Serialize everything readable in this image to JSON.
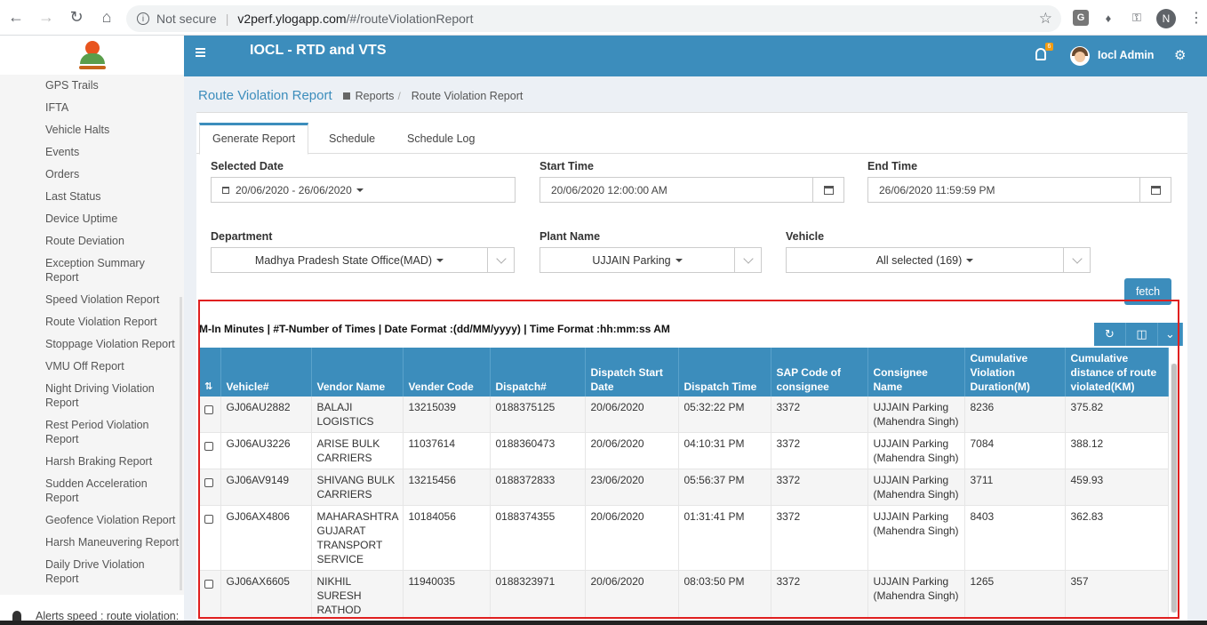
{
  "browser": {
    "security": "Not secure",
    "url_host": "v2perf.ylogapp.com",
    "url_path": "/#/routeViolationReport",
    "profile_initial": "N"
  },
  "sidebar": {
    "items": [
      "GPS Trails",
      "IFTA",
      "Vehicle Halts",
      "Events",
      "Orders",
      "Last Status",
      "Device Uptime",
      "Route Deviation",
      "Exception Summary Report",
      "Speed Violation Report",
      "Route Violation Report",
      "Stoppage Violation Report",
      "VMU Off Report",
      "Night Driving Violation Report",
      "Rest Period Violation Report",
      "Harsh Braking Report",
      "Sudden Acceleration Report",
      "Geofence Violation Report",
      "Harsh Maneuvering Report",
      "Daily Drive Violation Report"
    ],
    "alert_text": "Alerts speed : route violation:"
  },
  "header": {
    "title": "IOCL - RTD and VTS",
    "notification_count": "6",
    "user_name": "Iocl Admin"
  },
  "breadcrumb": {
    "title": "Route Violation Report",
    "parent": "Reports",
    "current": "Route Violation Report"
  },
  "tabs": [
    "Generate Report",
    "Schedule",
    "Schedule Log"
  ],
  "form": {
    "selected_date_label": "Selected Date",
    "selected_date_value": "20/06/2020 - 26/06/2020",
    "start_time_label": "Start Time",
    "start_time_value": "20/06/2020 12:00:00 AM",
    "end_time_label": "End Time",
    "end_time_value": "26/06/2020 11:59:59 PM",
    "department_label": "Department",
    "department_value": "Madhya Pradesh State Office(MAD)",
    "plant_label": "Plant Name",
    "plant_value": "UJJAIN Parking",
    "vehicle_label": "Vehicle",
    "vehicle_value": "All selected (169)",
    "fetch_label": "fetch"
  },
  "legend": "M-In Minutes | #T-Number of Times | Date Format :(dd/MM/yyyy) | Time Format :hh:mm:ss AM",
  "table": {
    "columns": [
      "Vehicle#",
      "Vendor Name",
      "Vender Code",
      "Dispatch#",
      "Dispatch Start Date",
      "Dispatch Time",
      "SAP Code of consignee",
      "Consignee Name",
      "Cumulative Violation Duration(M)",
      "Cumulative distance of route violated(KM)"
    ],
    "rows": [
      [
        "GJ06AU2882",
        "BALAJI LOGISTICS",
        "13215039",
        "0188375125",
        "20/06/2020",
        "05:32:22 PM",
        "3372",
        "UJJAIN Parking (Mahendra Singh)",
        "8236",
        "375.82"
      ],
      [
        "GJ06AU3226",
        "ARISE BULK CARRIERS",
        "11037614",
        "0188360473",
        "20/06/2020",
        "04:10:31 PM",
        "3372",
        "UJJAIN Parking (Mahendra Singh)",
        "7084",
        "388.12"
      ],
      [
        "GJ06AV9149",
        "SHIVANG BULK CARRIERS",
        "13215456",
        "0188372833",
        "23/06/2020",
        "05:56:37 PM",
        "3372",
        "UJJAIN Parking (Mahendra Singh)",
        "3711",
        "459.93"
      ],
      [
        "GJ06AX4806",
        "MAHARASHTRA GUJARAT TRANSPORT SERVICE",
        "10184056",
        "0188374355",
        "20/06/2020",
        "01:31:41 PM",
        "3372",
        "UJJAIN Parking (Mahendra Singh)",
        "8403",
        "362.83"
      ],
      [
        "GJ06AX6605",
        "NIKHIL SURESH RATHOD",
        "11940035",
        "0188323971",
        "20/06/2020",
        "08:03:50 PM",
        "3372",
        "UJJAIN Parking (Mahendra Singh)",
        "1265",
        "357"
      ]
    ]
  },
  "colors": {
    "primary": "#3c8dbc",
    "highlight": "#e02020"
  }
}
